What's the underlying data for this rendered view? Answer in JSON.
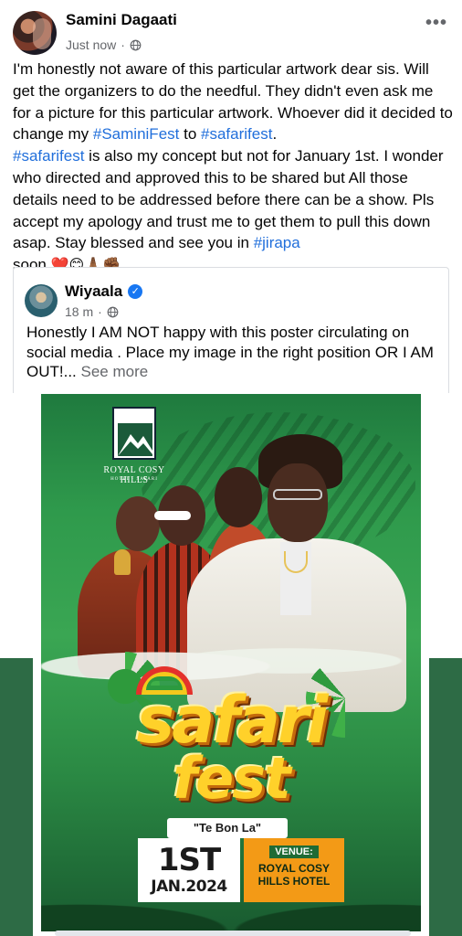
{
  "post": {
    "author": "Samini Dagaati",
    "time": "Just now",
    "separator": "·",
    "more_label": "•••",
    "text_parts": {
      "p1": "I'm honestly not aware of this particular artwork dear sis. Will get the organizers to do the needful. They didn't even ask me for a picture for this particular artwork. Whoever did it decided to change my ",
      "h1": "#SaminiFest",
      "p2": " to ",
      "h2": "#safarifest",
      "p3": ".",
      "h3": "#safarifest",
      "p4": " is also my concept but not for January 1st. I wonder who directed and approved this to be shared but All those details need to be addressed before there can be a show. Pls accept my apology and trust me to get them to pull this down asap. Stay blessed and see you in ",
      "h4": "#jirapa",
      "p5": "soon",
      "emojis": "❤️😊🙏🏾✊🏾",
      "p6": "."
    }
  },
  "shared_post": {
    "author": "Wiyaala",
    "verified_icon": "✓",
    "time": "18 m",
    "separator": "·",
    "text": "Honestly I AM NOT happy with this poster circulating on social media . Place my image in the right position OR I AM OUT!...",
    "see_more": "See more"
  },
  "poster": {
    "logo_name": "ROYAL COSY HILLS",
    "logo_sub": "HOTEL · SAFARI",
    "title_line1": "safari",
    "title_line2": "fest",
    "tagline": "\"Te Bon La\"",
    "date_big": "1ST",
    "date_small": "JAN.2024",
    "venue_label": "VENUE:",
    "venue_name": "ROYAL COSY HILLS HOTEL"
  },
  "colors": {
    "hashtag": "#216fdb",
    "meta_gray": "#65676b",
    "verified_blue": "#1877f2",
    "poster_green": "#2f9a4c",
    "title_yellow": "#ffd12a",
    "venue_orange": "#f39a16"
  },
  "icons": {
    "globe": "globe-icon",
    "more": "more-options-icon",
    "verified": "verified-badge-icon"
  }
}
